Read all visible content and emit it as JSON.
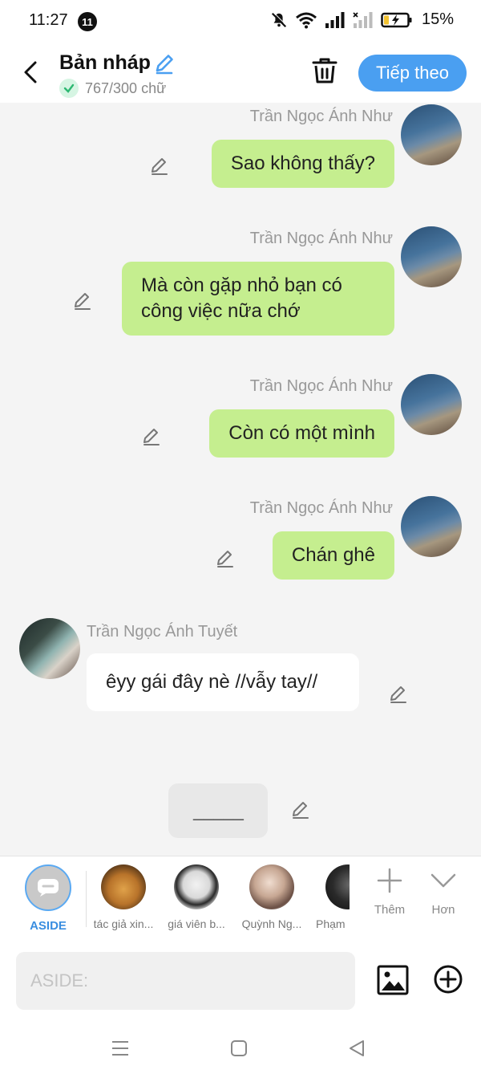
{
  "status_bar": {
    "time": "11:27",
    "notification_count": "11",
    "battery_percent": "15%"
  },
  "header": {
    "title": "Bản nháp",
    "word_count": "767/300 chữ",
    "next_button": "Tiếp theo"
  },
  "messages": [
    {
      "sender": "Trần Ngọc Ánh Như",
      "text": "Sao không thấy?"
    },
    {
      "sender": "Trần Ngọc Ánh Như",
      "text": "Mà còn gặp nhỏ bạn có công việc nữa chớ"
    },
    {
      "sender": "Trần Ngọc Ánh Như",
      "text": "Còn có một mình"
    },
    {
      "sender": "Trần Ngọc Ánh Như",
      "text": "Chán ghê"
    },
    {
      "sender": "Trần Ngọc Ánh Tuyết",
      "text": "êyy gái đây nè //vẫy tay//"
    }
  ],
  "placeholder_message": "_____",
  "character_bar": {
    "aside_label": "ASIDE",
    "characters": [
      {
        "label": "tác giả xin..."
      },
      {
        "label": "giá viên b..."
      },
      {
        "label": "Quỳnh Ng..."
      },
      {
        "label": "Phạm"
      }
    ],
    "more_label": "Thêm",
    "collapse_label": "Hơn"
  },
  "input": {
    "placeholder": "ASIDE:"
  },
  "colors": {
    "accent": "#4a9ff1",
    "bubble_right": "#c5ee8f",
    "bubble_left": "#ffffff"
  }
}
